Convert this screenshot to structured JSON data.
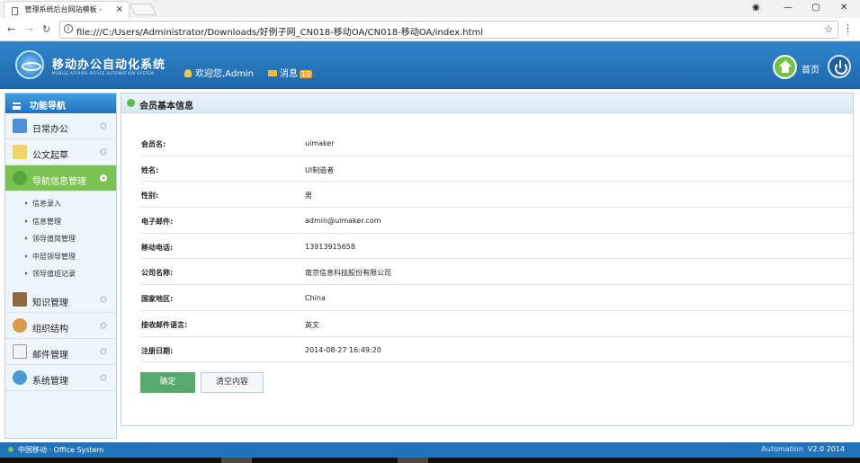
{
  "browser": {
    "tab_title": "管理系统后台网站模板 -",
    "url": "file:///C:/Users/Administrator/Downloads/好例子网_CN018-移动OA/CN018-移动OA/index.html"
  },
  "header": {
    "title": "移动办公自动化系统",
    "subtitle": "MOBILE AFFAIRS OFFICE AUTOMATION SYSTEM",
    "welcome": "欢迎您,Admin",
    "messages_label": "消息",
    "messages_count": "10",
    "home_label": "首页"
  },
  "sidebar": {
    "title": "功能导航",
    "items": [
      {
        "label": "日常办公",
        "icon": "monitor-icon"
      },
      {
        "label": "公文起草",
        "icon": "notebook-icon"
      },
      {
        "label": "导航信息管理",
        "icon": "tree-icon",
        "active": true
      },
      {
        "label": "知识管理",
        "icon": "book-icon"
      },
      {
        "label": "组织结构",
        "icon": "users-icon"
      },
      {
        "label": "邮件管理",
        "icon": "mail-icon"
      },
      {
        "label": "系统管理",
        "icon": "gear-icon"
      }
    ],
    "subitems": [
      "信息录入",
      "信息管理",
      "领导值岗管理",
      "中层领导管理",
      "领导值班记录"
    ]
  },
  "main": {
    "title": "会员基本信息",
    "fields": [
      {
        "label": "会员名:",
        "value": "uimaker"
      },
      {
        "label": "姓名:",
        "value": "UI制造者"
      },
      {
        "label": "性别:",
        "value": "男"
      },
      {
        "label": "电子邮件:",
        "value": "admin@uimaker.com"
      },
      {
        "label": "移动电话:",
        "value": "13913915658"
      },
      {
        "label": "公司名称:",
        "value": "南京信息科技股份有限公司"
      },
      {
        "label": "国家地区:",
        "value": "China"
      },
      {
        "label": "接收邮件语言:",
        "value": "英文"
      },
      {
        "label": "注册日期:",
        "value": "2014-08-27 16:49:20"
      }
    ],
    "confirm_label": "确定",
    "clear_label": "清空内容"
  },
  "footer": {
    "left": "中国移动 · Office System",
    "right_label": "Automation",
    "version": "V2.0 2014"
  },
  "colors": {
    "header": "#2274ba",
    "active": "#7ac353",
    "confirm": "#56aa70"
  }
}
